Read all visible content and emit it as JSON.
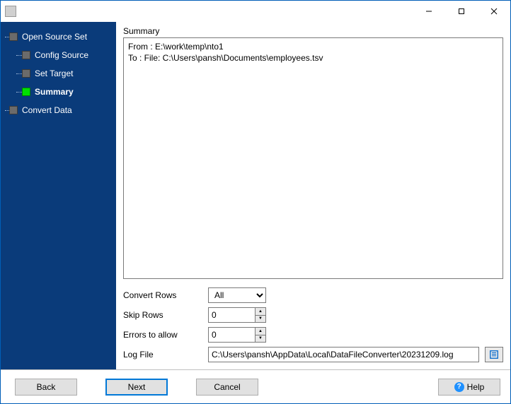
{
  "sidebar": {
    "items": [
      {
        "label": "Open Source Set",
        "child": false,
        "active": false,
        "bold": false
      },
      {
        "label": "Config Source",
        "child": true,
        "active": false,
        "bold": false
      },
      {
        "label": "Set Target",
        "child": true,
        "active": false,
        "bold": false
      },
      {
        "label": "Summary",
        "child": true,
        "active": true,
        "bold": true
      },
      {
        "label": "Convert Data",
        "child": false,
        "active": false,
        "bold": false
      }
    ]
  },
  "content": {
    "section_label": "Summary",
    "summary_lines": "From : E:\\work\\temp\\nto1\nTo : File: C:\\Users\\pansh\\Documents\\employees.tsv",
    "form": {
      "convert_rows_label": "Convert Rows",
      "convert_rows_value": "All",
      "skip_rows_label": "Skip Rows",
      "skip_rows_value": "0",
      "errors_label": "Errors to allow",
      "errors_value": "0",
      "log_file_label": "Log File",
      "log_file_value": "C:\\Users\\pansh\\AppData\\Local\\DataFileConverter\\20231209.log"
    }
  },
  "buttons": {
    "back": "Back",
    "next": "Next",
    "cancel": "Cancel",
    "help": "Help"
  }
}
